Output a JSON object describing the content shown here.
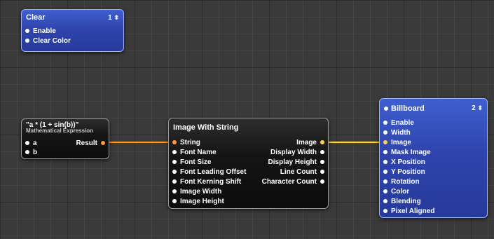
{
  "colors": {
    "blue_patch": "#2f45ad",
    "dark_patch": "#151515",
    "wire_orange": "#ff9a2e",
    "wire_yellow": "#ffd34a"
  },
  "patches": {
    "clear": {
      "title": "Clear",
      "number": "1",
      "inputs": [
        "Enable",
        "Clear Color"
      ]
    },
    "math": {
      "title": "\"a * (1 + sin(b))\"",
      "subtitle": "Mathematical Expression",
      "inputs": [
        "a",
        "b"
      ],
      "outputs": [
        "Result"
      ]
    },
    "image_string": {
      "title": "Image With String",
      "inputs": [
        "String",
        "Font Name",
        "Font Size",
        "Font Leading Offset",
        "Font Kerning Shift",
        "Image Width",
        "Image Height"
      ],
      "outputs": [
        "Image",
        "Display Width",
        "Display Height",
        "Line Count",
        "Character Count"
      ]
    },
    "billboard": {
      "title": "Billboard",
      "number": "2",
      "inputs": [
        "Enable",
        "Width",
        "Image",
        "Mask Image",
        "X Position",
        "Y Position",
        "Rotation",
        "Color",
        "Blending",
        "Pixel Aligned"
      ]
    }
  },
  "connections": [
    {
      "from": "Result",
      "to": "String",
      "color": "orange"
    },
    {
      "from": "Image",
      "to": "Image",
      "color": "yellow"
    }
  ]
}
